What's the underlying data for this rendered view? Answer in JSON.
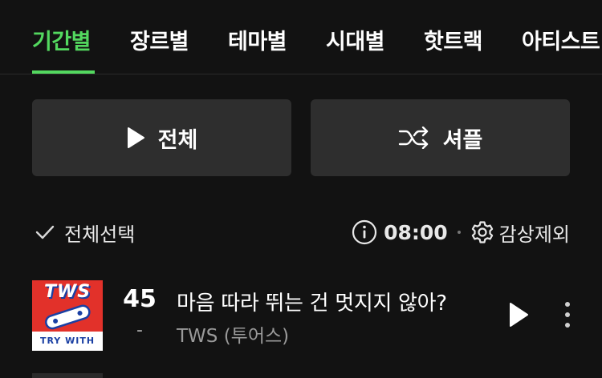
{
  "tabs": [
    {
      "label": "기간별",
      "active": true
    },
    {
      "label": "장르별",
      "active": false
    },
    {
      "label": "테마별",
      "active": false
    },
    {
      "label": "시대별",
      "active": false
    },
    {
      "label": "핫트랙",
      "active": false
    },
    {
      "label": "아티스트",
      "active": false
    }
  ],
  "actions": {
    "play_all_label": "전체",
    "shuffle_label": "셔플"
  },
  "toolbar": {
    "select_all_label": "전체선택",
    "time": "08:00",
    "exclude_label": "감상제외"
  },
  "track": {
    "rank": "45",
    "rank_change": "-",
    "title": "마음 따라 뛰는 건 멋지지 않아?",
    "artist": "TWS (투어스)",
    "cover_title": "TWS",
    "cover_caption": "TRY WITH US"
  },
  "colors": {
    "accent": "#53d85f",
    "background": "#121212",
    "button_bg": "#2e2e2e",
    "cover_red": "#e2312a"
  },
  "icons": [
    "play-icon",
    "shuffle-icon",
    "checkmark-icon",
    "info-icon",
    "gear-icon",
    "more-vertical-icon"
  ]
}
